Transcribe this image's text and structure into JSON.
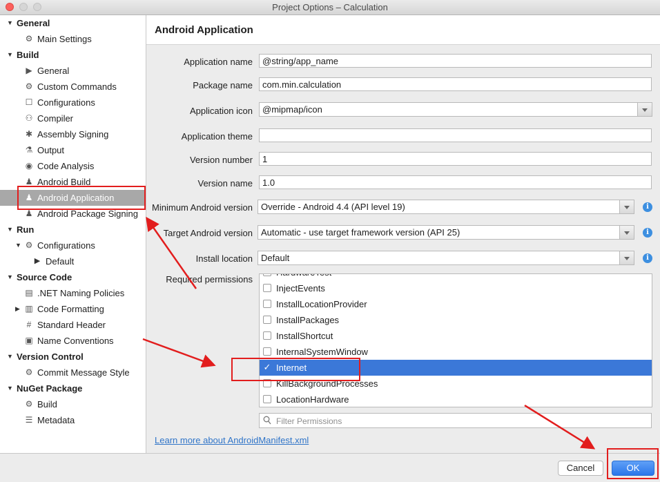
{
  "window": {
    "title": "Project Options – Calculation"
  },
  "sidebar": {
    "items": [
      {
        "kind": "group",
        "label": "General",
        "expanded": true
      },
      {
        "kind": "item",
        "label": "Main Settings",
        "icon": "gear-icon"
      },
      {
        "kind": "group",
        "label": "Build",
        "expanded": true
      },
      {
        "kind": "item",
        "label": "General",
        "icon": "build-general-icon"
      },
      {
        "kind": "item",
        "label": "Custom Commands",
        "icon": "gear-icon"
      },
      {
        "kind": "item",
        "label": "Configurations",
        "icon": "configurations-icon"
      },
      {
        "kind": "item",
        "label": "Compiler",
        "icon": "compiler-icon"
      },
      {
        "kind": "item",
        "label": "Assembly Signing",
        "icon": "badge-icon"
      },
      {
        "kind": "item",
        "label": "Output",
        "icon": "flask-icon"
      },
      {
        "kind": "item",
        "label": "Code Analysis",
        "icon": "target-icon"
      },
      {
        "kind": "item",
        "label": "Android Build",
        "icon": "android-icon"
      },
      {
        "kind": "item",
        "label": "Android Application",
        "icon": "android-icon",
        "selected": true
      },
      {
        "kind": "item",
        "label": "Android Package Signing",
        "icon": "android-icon"
      },
      {
        "kind": "group",
        "label": "Run",
        "expanded": true
      },
      {
        "kind": "item",
        "label": "Configurations",
        "icon": "gear-icon",
        "expanded": true
      },
      {
        "kind": "item",
        "label": "Default",
        "icon": "play-icon"
      },
      {
        "kind": "group",
        "label": "Source Code",
        "expanded": true
      },
      {
        "kind": "item",
        "label": ".NET Naming Policies",
        "icon": "naming-icon"
      },
      {
        "kind": "item",
        "label": "Code Formatting",
        "icon": "formatting-icon",
        "collapsed": true
      },
      {
        "kind": "item",
        "label": "Standard Header",
        "icon": "header-icon"
      },
      {
        "kind": "item",
        "label": "Name Conventions",
        "icon": "conventions-icon"
      },
      {
        "kind": "group",
        "label": "Version Control",
        "expanded": true
      },
      {
        "kind": "item",
        "label": "Commit Message Style",
        "icon": "gear-icon"
      },
      {
        "kind": "group",
        "label": "NuGet Package",
        "expanded": true
      },
      {
        "kind": "item",
        "label": "Build",
        "icon": "gear-icon"
      },
      {
        "kind": "item",
        "label": "Metadata",
        "icon": "metadata-icon"
      }
    ]
  },
  "content": {
    "title": "Android Application",
    "fields": {
      "app_name": {
        "label": "Application name",
        "value": "@string/app_name"
      },
      "package_name": {
        "label": "Package name",
        "value": "com.min.calculation"
      },
      "app_icon": {
        "label": "Application icon",
        "value": "@mipmap/icon"
      },
      "app_theme": {
        "label": "Application theme",
        "value": ""
      },
      "version_number": {
        "label": "Version number",
        "value": "1"
      },
      "version_name": {
        "label": "Version name",
        "value": "1.0"
      },
      "min_android": {
        "label": "Minimum Android version",
        "value": "Override - Android 4.4 (API level 19)"
      },
      "target_android": {
        "label": "Target Android version",
        "value": "Automatic - use target framework version (API 25)"
      },
      "install_location": {
        "label": "Install location",
        "value": "Default"
      }
    },
    "permissions_label": "Required permissions",
    "permissions": [
      {
        "label": "HardwareTest",
        "checked": false
      },
      {
        "label": "InjectEvents",
        "checked": false
      },
      {
        "label": "InstallLocationProvider",
        "checked": false
      },
      {
        "label": "InstallPackages",
        "checked": false
      },
      {
        "label": "InstallShortcut",
        "checked": false
      },
      {
        "label": "InternalSystemWindow",
        "checked": false
      },
      {
        "label": "Internet",
        "checked": true,
        "selected": true
      },
      {
        "label": "KillBackgroundProcesses",
        "checked": false
      },
      {
        "label": "LocationHardware",
        "checked": false
      }
    ],
    "filter_placeholder": "Filter Permissions",
    "learn_more": "Learn more about AndroidManifest.xml"
  },
  "footer": {
    "cancel_label": "Cancel",
    "ok_label": "OK"
  },
  "colors": {
    "selection_blue": "#3b78d8",
    "sidebar_selected": "#a8a8a8",
    "annotation_red": "#e21d1d",
    "ok_button": "#2a76ea",
    "link": "#2f74c8"
  }
}
